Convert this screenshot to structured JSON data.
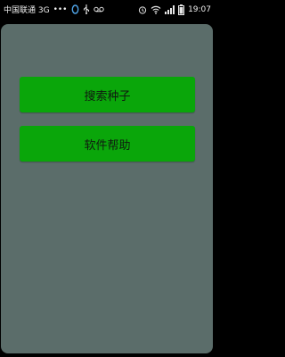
{
  "status_bar": {
    "carrier": "中国联通 3G",
    "overflow_dots": "•••",
    "time": "19:07",
    "icons": [
      "flower-icon",
      "usb-icon",
      "recorder-icon",
      "alarm-icon",
      "wifi-icon",
      "signal-icon",
      "battery-icon"
    ]
  },
  "main": {
    "buttons": [
      {
        "label": "搜索种子"
      },
      {
        "label": "软件帮助"
      }
    ]
  },
  "colors": {
    "background": "#5b6d6a",
    "button": "#0aa60a",
    "status_bar": "#000000"
  }
}
